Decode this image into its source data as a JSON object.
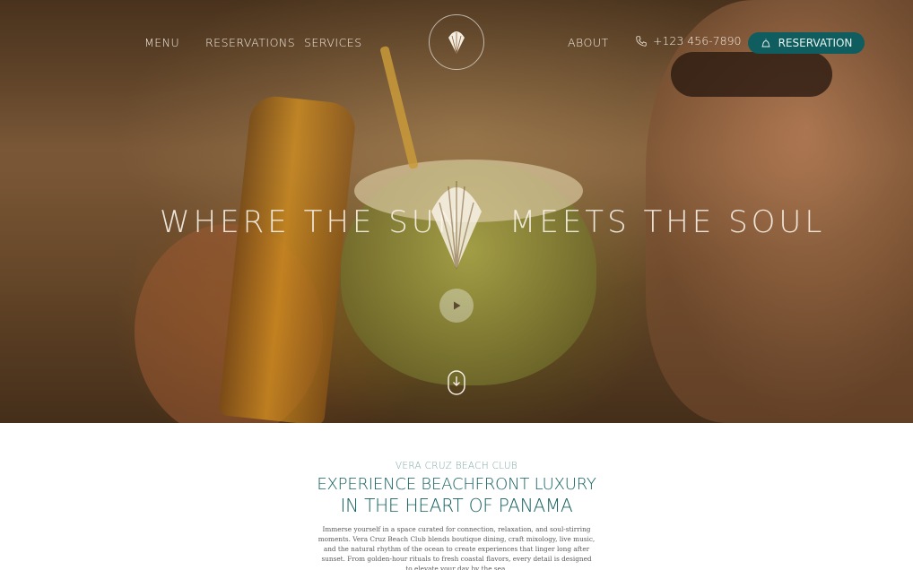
{
  "nav": {
    "menu_label": "MENU",
    "reservations_label": "RESERVATIONS",
    "services_label": "SERVICES",
    "about_label": "ABOUT",
    "phone": "+123 456-7890",
    "reservation_button": "RESERVATION"
  },
  "hero": {
    "headline_left": "WHERE THE SUN",
    "headline_right": "MEETS THE SOUL"
  },
  "intro": {
    "eyebrow": "VERA CRUZ BEACH CLUB",
    "title_line1": "EXPERIENCE BEACHFRONT LUXURY",
    "title_line2": "IN THE HEART OF PANAMA",
    "body": "Immerse yourself in a space curated for connection, relaxation, and soul-stirring moments. Vera Cruz Beach Club blends boutique dining, craft mixology, live music, and the natural rhythm of the ocean to create experiences that linger long after sunset. From golden-hour rituals to fresh coastal flavors, every detail is designed to elevate your day by the sea."
  },
  "colors": {
    "accent": "#0f5d5e",
    "title": "#145f5f",
    "eyebrow": "#7fa6a4"
  },
  "icons": {
    "logo": "shell-logo-icon",
    "phone": "phone-icon",
    "reservation": "bell-icon",
    "play": "play-icon",
    "scroll": "mouse-scroll-icon"
  }
}
